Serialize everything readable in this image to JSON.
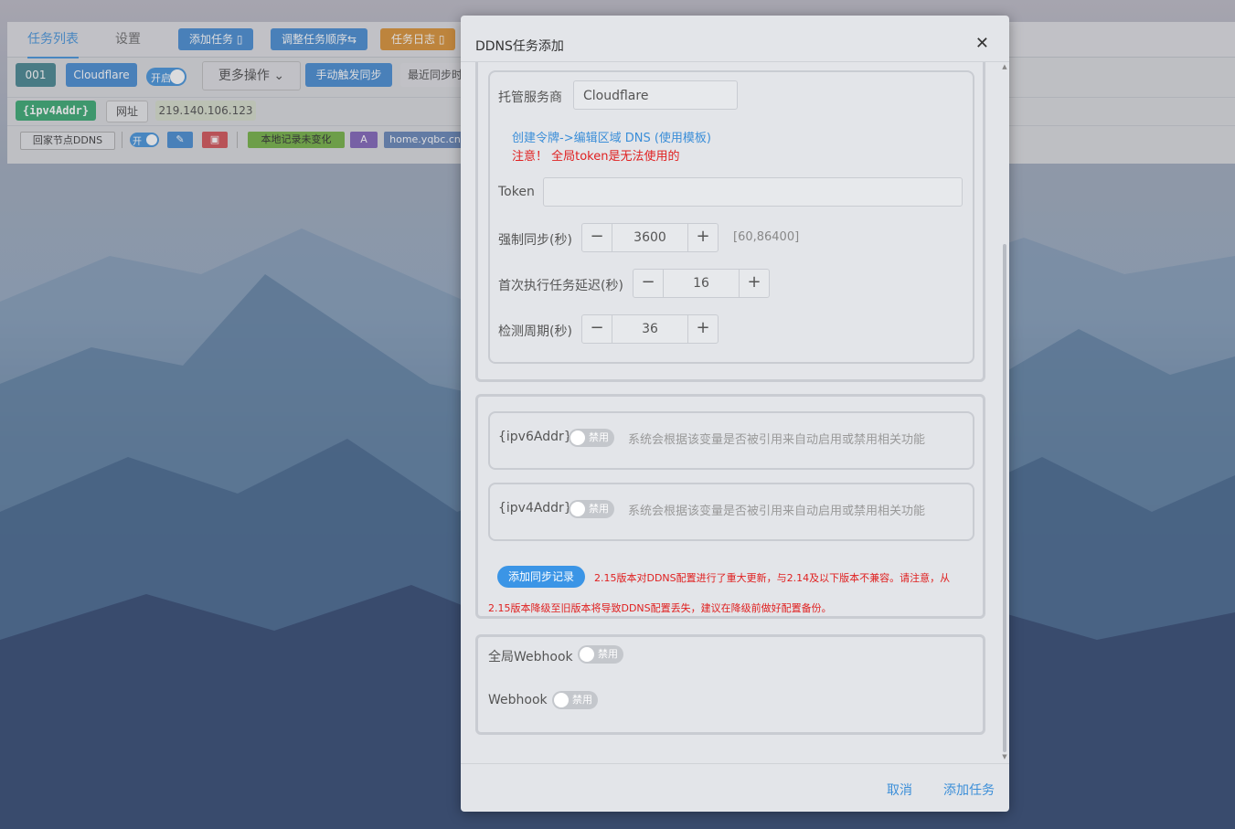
{
  "background_app": {
    "tabs": [
      {
        "label": "任务列表",
        "active": true
      },
      {
        "label": "设置",
        "active": false
      }
    ],
    "toolbar": {
      "add_task": "添加任务",
      "adjust_order": "调整任务顺序",
      "task_log": "任务日志"
    },
    "task_row": {
      "id": "001",
      "provider": "Cloudflare",
      "switch_label": "开启",
      "more_ops": "更多操作",
      "manual_sync": "手动触发同步",
      "last_sync": "最近同步时"
    },
    "var_row": {
      "var": "{ipv4Addr}",
      "url_label": "网址",
      "ip": "219.140.106.123"
    },
    "record_row": {
      "name": "回家节点DDNS",
      "switch_label": "开",
      "status": "本地记录未变化",
      "type": "A",
      "domain": "home.yqbc.cn"
    }
  },
  "modal": {
    "title": "DDNS任务添加",
    "close_icon": "close-icon",
    "provider": {
      "label": "托管服务商",
      "value": "Cloudflare"
    },
    "token_link": "创建令牌->编辑区域 DNS (使用模板)",
    "token_warning": "注意！ 全局token是无法使用的",
    "token": {
      "label": "Token",
      "value": ""
    },
    "force_sync": {
      "label": "强制同步(秒)",
      "value": "3600",
      "range": "[60,86400]"
    },
    "first_delay": {
      "label": "首次执行任务延迟(秒)",
      "value": "16"
    },
    "check_period": {
      "label": "检测周期(秒)",
      "value": "36"
    },
    "ipv6": {
      "label": "{ipv6Addr}",
      "switch": "禁用",
      "desc": "系统会根据该变量是否被引用来自动启用或禁用相关功能"
    },
    "ipv4": {
      "label": "{ipv4Addr}",
      "switch": "禁用",
      "desc": "系统会根据该变量是否被引用来自动启用或禁用相关功能"
    },
    "add_record_button": "添加同步记录",
    "notice_line1": "2.15版本对DDNS配置进行了重大更新，与2.14及以下版本不兼容。请注意，从",
    "notice_line2": "2.15版本降级至旧版本将导致DDNS配置丢失，建议在降级前做好配置备份。",
    "global_webhook": {
      "label": "全局Webhook",
      "switch": "禁用"
    },
    "webhook": {
      "label": "Webhook",
      "switch": "禁用"
    },
    "footer": {
      "cancel": "取消",
      "submit": "添加任务"
    }
  },
  "colors": {
    "accent": "#3b8ed8",
    "warning": "#e02020",
    "modal_bg": "#e3e5e9"
  }
}
